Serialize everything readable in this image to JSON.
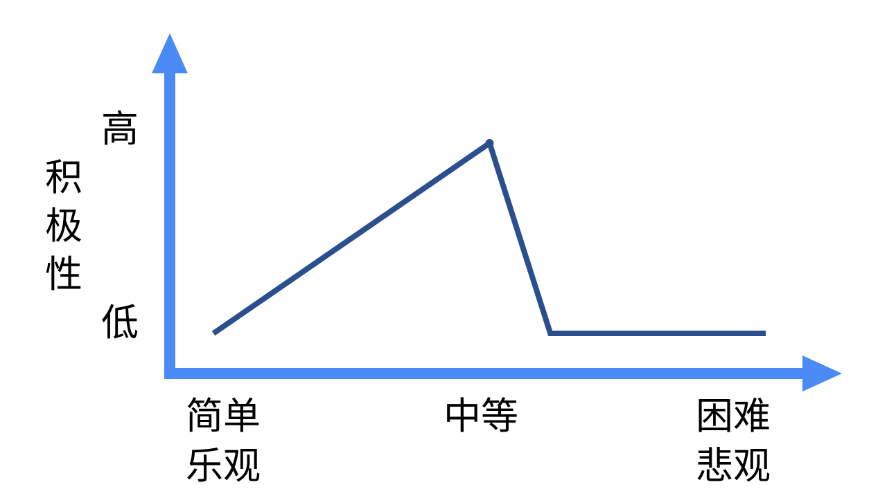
{
  "chart_data": {
    "type": "line",
    "y_axis": {
      "title": "积极性",
      "tick_labels": [
        "低",
        "高"
      ]
    },
    "x_axis": {
      "categories": [
        {
          "top": "简单",
          "bottom": "乐观"
        },
        {
          "top": "中等",
          "bottom": ""
        },
        {
          "top": "困难",
          "bottom": "悲观"
        }
      ]
    },
    "series": [
      {
        "points": [
          {
            "x": 0.0,
            "y": 0.0
          },
          {
            "x": 1.0,
            "y": 1.0
          },
          {
            "x": 1.22,
            "y": 0.0
          },
          {
            "x": 2.0,
            "y": 0.0
          }
        ]
      }
    ],
    "xlim": [
      0,
      2
    ],
    "ylim": [
      0,
      1
    ],
    "grid": false,
    "colors": {
      "axis": "#4A8AF4",
      "line": "#2A4E8E"
    }
  }
}
